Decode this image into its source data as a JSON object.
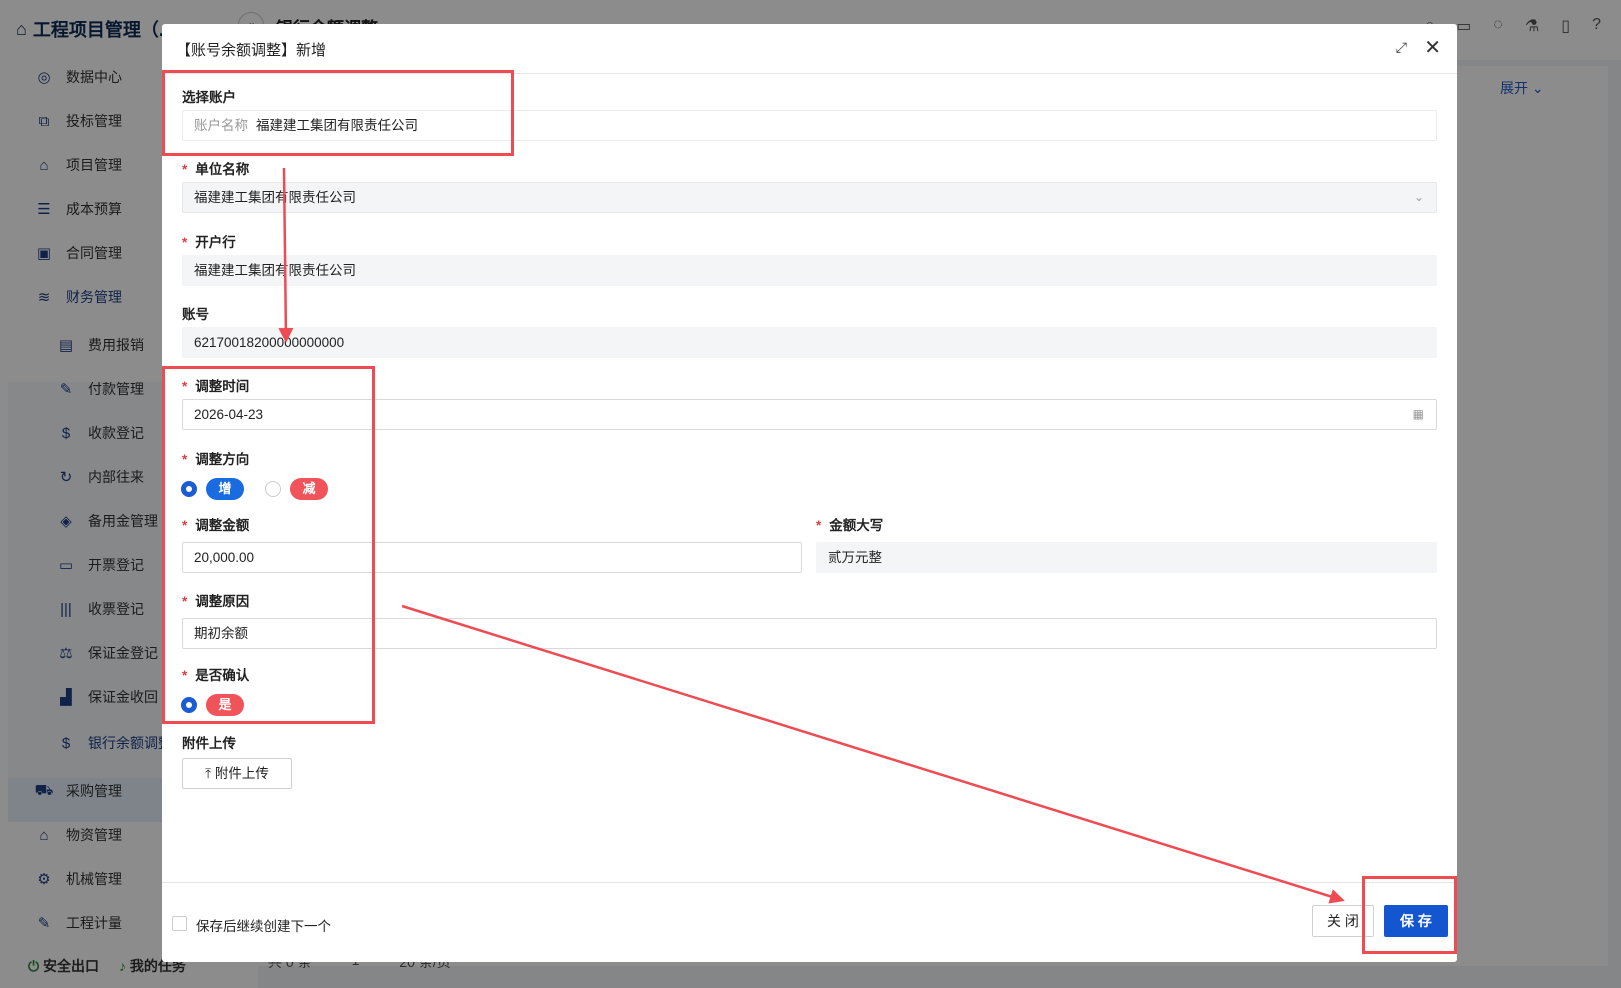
{
  "background": {
    "app_title": "工程项目管理（...",
    "page_title": "银行余额调整",
    "expand_label": "展开",
    "menu": [
      {
        "label": "数据中心",
        "icon": "compass-icon"
      },
      {
        "label": "投标管理",
        "icon": "network-icon"
      },
      {
        "label": "项目管理",
        "icon": "house-icon"
      },
      {
        "label": "成本预算",
        "icon": "stack-icon"
      },
      {
        "label": "合同管理",
        "icon": "briefcase-icon"
      },
      {
        "label": "财务管理",
        "icon": "coins-icon"
      }
    ],
    "submenu": [
      {
        "label": "费用报销",
        "icon": "cash-icon"
      },
      {
        "label": "付款管理",
        "icon": "edit-icon"
      },
      {
        "label": "收款登记",
        "icon": "hand-coin-icon"
      },
      {
        "label": "内部往来",
        "icon": "refresh-icon"
      },
      {
        "label": "备用金管理",
        "icon": "layers-icon"
      },
      {
        "label": "开票登记",
        "icon": "ticket-icon"
      },
      {
        "label": "收票登记",
        "icon": "barcode-icon"
      },
      {
        "label": "保证金登记",
        "icon": "scale-icon"
      },
      {
        "label": "保证金收回",
        "icon": "bar-icon"
      },
      {
        "label": "银行余额调整",
        "icon": "money-bag-icon"
      }
    ],
    "menu_lower": [
      {
        "label": "采购管理",
        "icon": "truck-icon"
      },
      {
        "label": "物资管理",
        "icon": "warehouse-icon"
      },
      {
        "label": "机械管理",
        "icon": "gears-icon"
      },
      {
        "label": "工程计量",
        "icon": "pencil-icon"
      }
    ],
    "bottom": {
      "exit": "安全出口",
      "tasks": "我的任务"
    },
    "pager": {
      "total": "共 0 条",
      "page": "1",
      "size": "20 条/页"
    }
  },
  "modal": {
    "title": "【账号余额调整】新增",
    "fields": {
      "account_select": {
        "label": "选择账户",
        "prefix": "账户名称",
        "value": "福建建工集团有限责任公司"
      },
      "unit_name": {
        "label": "单位名称",
        "value": "福建建工集团有限责任公司"
      },
      "bank": {
        "label": "开户行",
        "value": "福建建工集团有限责任公司"
      },
      "account_no": {
        "label": "账号",
        "value": "62170018200000000000"
      },
      "adjust_date": {
        "label": "调整时间",
        "value": "2026-04-23"
      },
      "direction": {
        "label": "调整方向",
        "options": [
          "增",
          "减"
        ],
        "selected": "增"
      },
      "amount": {
        "label": "调整金额",
        "value": "20,000.00"
      },
      "amount_upper": {
        "label": "金额大写",
        "value": "贰万元整"
      },
      "reason": {
        "label": "调整原因",
        "value": "期初余额"
      },
      "confirmed": {
        "label": "是否确认",
        "option": "是"
      },
      "attachment": {
        "label": "附件上传",
        "button": "附件上传"
      }
    },
    "footer": {
      "continue_label": "保存后继续创建下一个",
      "close_label": "关 闭",
      "save_label": "保 存"
    }
  },
  "colors": {
    "primary": "#1456cf",
    "danger": "#f0545a",
    "annotation": "#ee4b53"
  }
}
